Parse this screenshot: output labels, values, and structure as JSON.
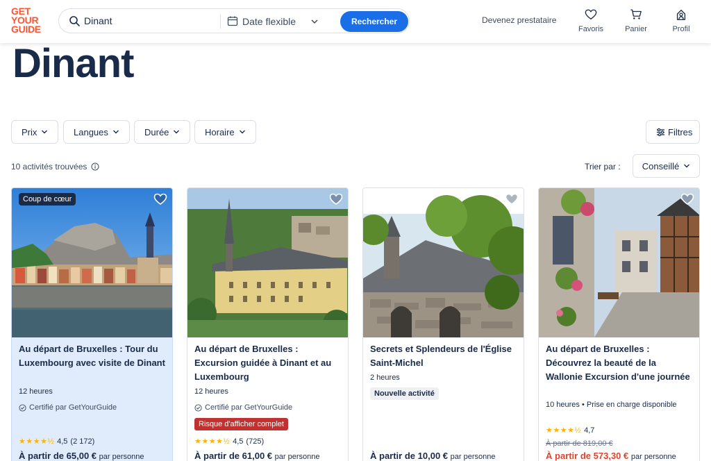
{
  "header": {
    "logo_lines": [
      "GET",
      "YOUR",
      "GUIDE"
    ],
    "search_value": "Dinant",
    "date_label": "Date flexible",
    "search_button": "Rechercher",
    "become_provider": "Devenez prestataire",
    "nav": [
      {
        "label": "Favoris",
        "icon": "heart-icon"
      },
      {
        "label": "Panier",
        "icon": "cart-icon"
      },
      {
        "label": "Profil",
        "icon": "profile-icon"
      }
    ]
  },
  "page": {
    "title": "Dinant"
  },
  "filters": {
    "items": [
      "Prix",
      "Langues",
      "Durée",
      "Horaire"
    ],
    "all_filters": "Filtres"
  },
  "results": {
    "count_text": "10 activités trouvées",
    "sort_label": "Trier par :",
    "sort_value": "Conseillé"
  },
  "cards": [
    {
      "badge": "Coup de cœur",
      "title": "Au départ de Bruxelles : Tour du Luxembourg avec visite de Dinant",
      "duration": "12 heures",
      "certified": "Certifié par GetYourGuide",
      "rating": "4,5",
      "reviews": "(2 172)",
      "price_prefix": "À partir de",
      "price": "65,00 €",
      "price_suffix": "par personne"
    },
    {
      "title": "Au départ de Bruxelles : Excursion guidée à Dinant et au Luxembourg",
      "duration": "12 heures",
      "certified": "Certifié par GetYourGuide",
      "risk": "Risque d'afficher complet",
      "rating": "4,5",
      "reviews": "(725)",
      "price_prefix": "À partir de",
      "price": "61,00 €",
      "price_suffix": "par personne"
    },
    {
      "title": "Secrets et Splendeurs de l'Église Saint-Michel",
      "duration": "2 heures",
      "new_badge": "Nouvelle activité",
      "price_prefix": "À partir de",
      "price": "10,00 €",
      "price_suffix": "par personne"
    },
    {
      "title": "Au départ de Bruxelles : Découvrez la beauté de la Wallonie Excursion d'une journée",
      "duration": "10 heures • Prise en charge disponible",
      "rating": "4,7",
      "old_price": "À partir de 819,00 €",
      "price_prefix": "À partir de",
      "price": "573,30 €",
      "price_suffix": "par personne"
    }
  ],
  "colors": {
    "brand_orange": "#ff5533",
    "primary_blue": "#1a6ee8",
    "navy": "#1a2b49",
    "featured_bg": "#e0ecfb",
    "risk_red": "#c0312f",
    "star": "#ffb400"
  }
}
